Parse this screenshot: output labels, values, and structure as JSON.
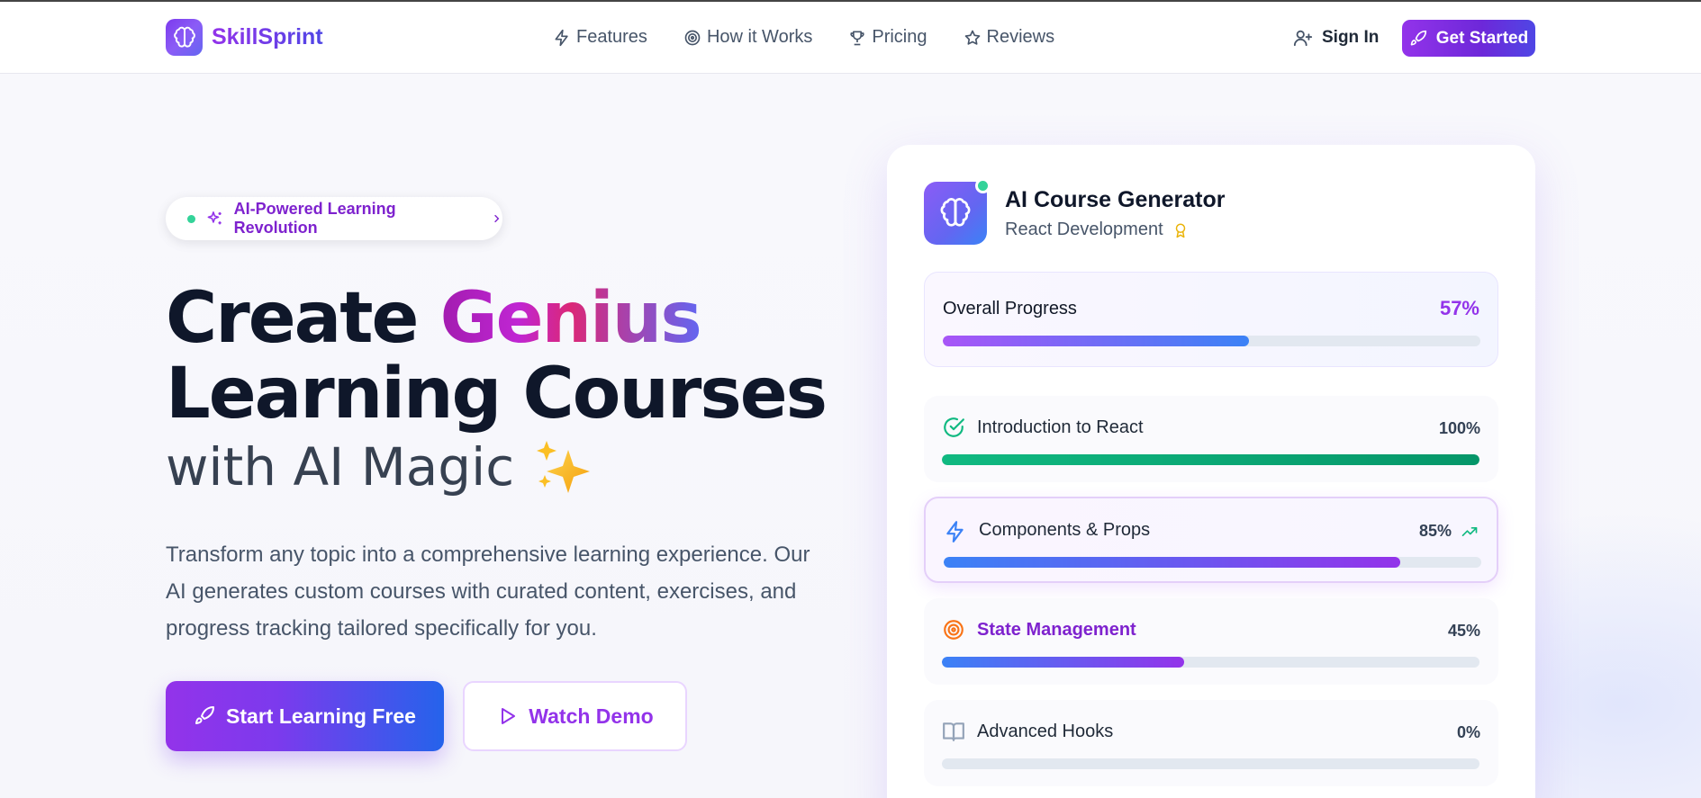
{
  "nav": {
    "brand": "SkillSprint",
    "links": [
      {
        "label": "Features",
        "icon": "bolt-icon"
      },
      {
        "label": "How it Works",
        "icon": "target-icon"
      },
      {
        "label": "Pricing",
        "icon": "trophy-icon"
      },
      {
        "label": "Reviews",
        "icon": "star-icon"
      }
    ],
    "sign_in": "Sign In",
    "get_started": "Get Started"
  },
  "hero": {
    "badge": "AI-Powered Learning Revolution",
    "title_part1": "Create ",
    "title_highlight": "Genius",
    "title_line2": "Learning Courses",
    "subtitle": "with AI Magic",
    "subtitle_emoji": "sparkles-icon",
    "description": "Transform any topic into a comprehensive learning experience. Our AI generates custom courses with curated content, exercises, and progress tracking tailored specifically for you.",
    "primary_button": "Start Learning Free",
    "secondary_button": "Watch Demo"
  },
  "card": {
    "title": "AI Course Generator",
    "subtitle": "React Development",
    "overall_label": "Overall Progress",
    "overall_percent": "57%",
    "overall_value": 0.57,
    "modules": [
      {
        "name": "Introduction to React",
        "percent": "100%",
        "value": 1.0,
        "status": "complete",
        "icon": "check-circle-icon"
      },
      {
        "name": "Components & Props",
        "percent": "85%",
        "value": 0.85,
        "status": "active",
        "icon": "bolt-icon"
      },
      {
        "name": "State Management",
        "percent": "45%",
        "value": 0.45,
        "status": "in-progress",
        "icon": "target-icon"
      },
      {
        "name": "Advanced Hooks",
        "percent": "0%",
        "value": 0.0,
        "status": "locked",
        "icon": "book-icon"
      }
    ]
  },
  "colors": {
    "accent": "#9333ea",
    "blue": "#3b82f6",
    "green": "#10b981",
    "orange": "#f97316"
  }
}
